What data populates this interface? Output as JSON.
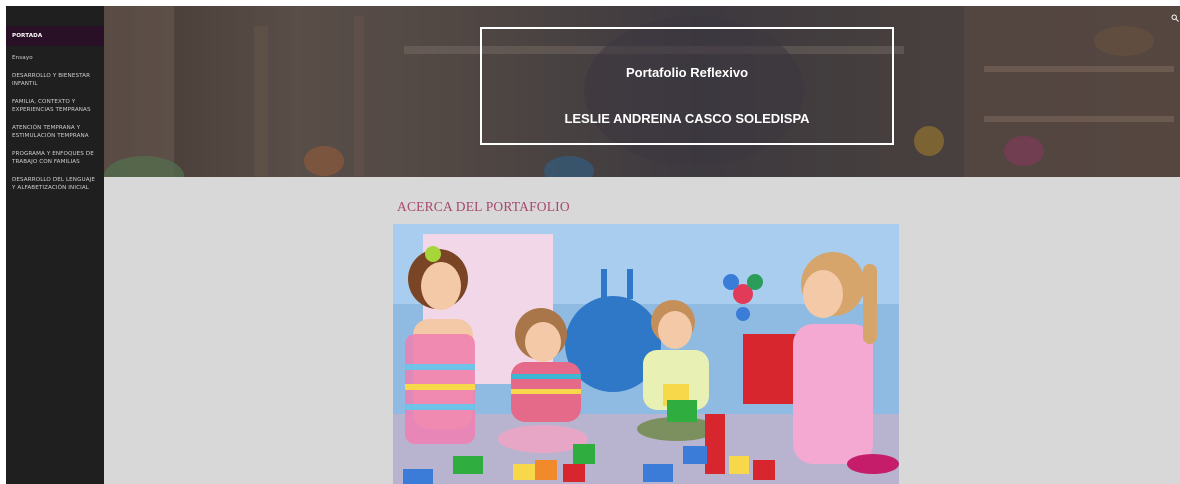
{
  "sidebar": {
    "items": [
      {
        "label": "PORTADA",
        "active": true
      },
      {
        "label": "Ensayo"
      },
      {
        "label": "DESARROLLO Y BIENESTAR INFANTIL"
      },
      {
        "label": "FAMILIA, CONTEXTO Y EXPERIENCIAS TEMPRANAS"
      },
      {
        "label": "ATENCIÓN TEMPRANA Y ESTIMULACIÓN TEMPRANA"
      },
      {
        "label": "PROGRAMA Y ENFOQUES DE TRABAJO CON FAMILIAS"
      },
      {
        "label": "DESARROLLO DEL LENGUAJE Y ALFABETIZACIÓN INICIAL"
      }
    ]
  },
  "header": {
    "title": "Portafolio Reflexivo",
    "author": "LESLIE ANDREINA CASCO SOLEDISPA",
    "search_icon": "search-icon"
  },
  "main": {
    "section_title": "ACERCA DEL  PORTAFOLIO"
  },
  "colors": {
    "sidebar_bg": "#1f1f1f",
    "active_item_bg": "#2a1027",
    "content_bg": "#d8d8d8",
    "section_title": "#a7486f"
  }
}
